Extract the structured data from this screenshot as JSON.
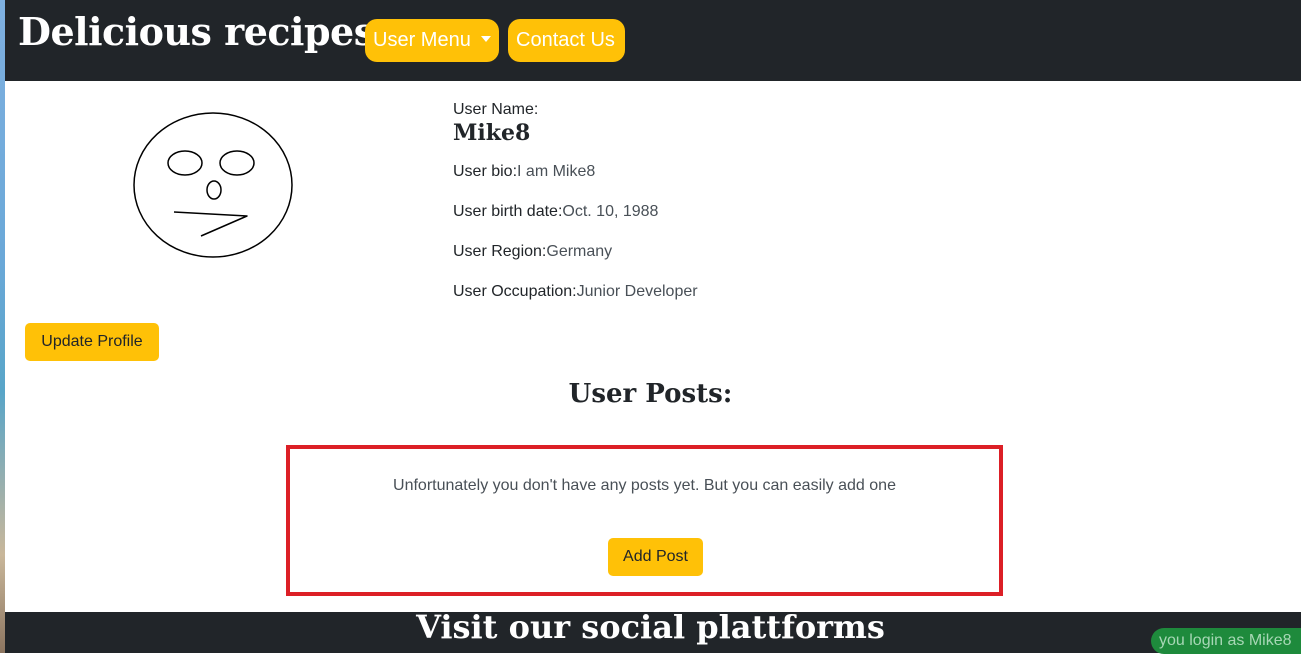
{
  "header": {
    "brand": "Delicious recipes",
    "user_menu_label": "User Menu",
    "contact_label": "Contact Us"
  },
  "profile": {
    "username_label": "User Name:",
    "username": "Mike8",
    "bio_label": "User bio:",
    "bio": "I am Mike8",
    "birth_label": "User birth date:",
    "birth": "Oct. 10, 1988",
    "region_label": "User Region:",
    "region": "Germany",
    "occupation_label": "User Occupation:",
    "occupation": "Junior Developer",
    "update_button": "Update Profile"
  },
  "posts": {
    "title": "User Posts:",
    "empty_message": "Unfortunately you don't have any posts yet. But you can easily add one",
    "add_button": "Add Post"
  },
  "footer": {
    "title": "Visit our social plattforms"
  },
  "status": {
    "login_text": "you login as Mike8"
  },
  "colors": {
    "navbar": "#212529",
    "accent": "#ffc107",
    "highlight_border": "#dc1f26",
    "login_badge": "#1e8a3c"
  }
}
